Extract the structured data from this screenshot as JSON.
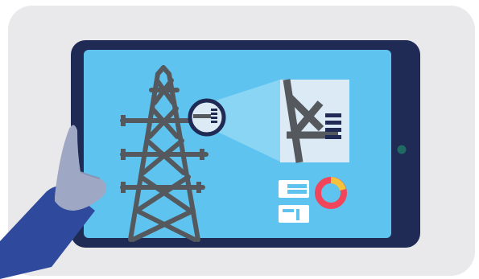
{
  "scene": {
    "subject": "tablet-with-transmission-tower-inspection",
    "icons": [
      "tablet-icon",
      "hand-icon",
      "transmission-tower-icon",
      "magnifier-icon",
      "zoom-beam-icon",
      "detail-panel-icon",
      "layout-blocks-icon",
      "donut-chart-icon"
    ]
  },
  "colors": {
    "card_background": "#e9e9eb",
    "tablet_frame": "#1f2a55",
    "screen": "#5ec4ef",
    "tower": "#55595e",
    "detail_panel": "#dceaf6",
    "hand_skin": "#9ea7c3",
    "sleeve": "#2f4a9c",
    "donut_red": "#f0455a",
    "donut_yellow": "#f5c23c",
    "camera_dot": "#1f6b63",
    "white": "#ffffff"
  }
}
